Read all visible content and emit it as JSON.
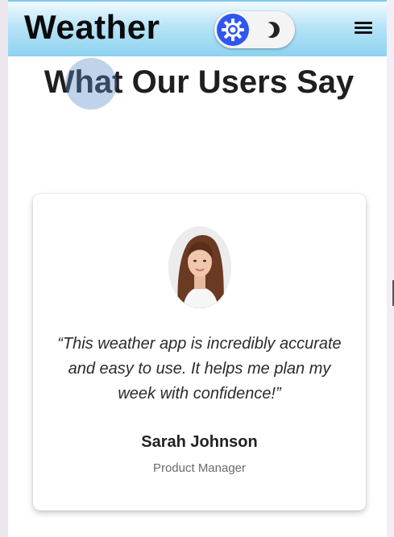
{
  "navbar": {
    "brand": "Weather",
    "theme_toggle": {
      "light_icon": "sun-icon",
      "dark_icon": "moon-icon",
      "active_mode": "light",
      "accent_color": "#2f56f0"
    },
    "menu_icon": "hamburger-icon"
  },
  "testimonials": {
    "title": "What Our Users Say",
    "item": {
      "avatar_icon": "woman-portrait",
      "quote": "“This weather app is incredibly accurate and easy to use. It helps me plan my week with confidence!”",
      "name": "Sarah Johnson",
      "role": "Product Manager"
    }
  }
}
